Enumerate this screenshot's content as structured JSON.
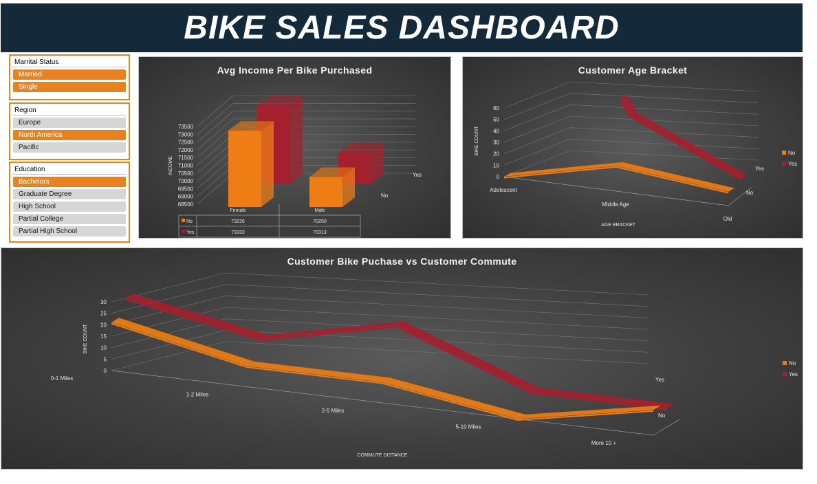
{
  "header": {
    "title": "BIKE SALES DASHBOARD"
  },
  "colors": {
    "no": "#ee7d15",
    "yes": "#a5202e",
    "accent": "#e8821e",
    "header_bg": "#14293a"
  },
  "slicers": {
    "marital": {
      "title": "Marrital Status",
      "items": [
        {
          "label": "Married",
          "selected": true
        },
        {
          "label": "Single",
          "selected": true
        }
      ]
    },
    "region": {
      "title": "Region",
      "items": [
        {
          "label": "Europe",
          "selected": false
        },
        {
          "label": "North America",
          "selected": true
        },
        {
          "label": "Pacific",
          "selected": false
        }
      ]
    },
    "education": {
      "title": "Education",
      "items": [
        {
          "label": "Bachelors",
          "selected": true
        },
        {
          "label": "Graduate Degree",
          "selected": false
        },
        {
          "label": "High School",
          "selected": false
        },
        {
          "label": "Partial College",
          "selected": false
        },
        {
          "label": "Partial High School",
          "selected": false
        }
      ]
    }
  },
  "chart_data": [
    {
      "type": "bar",
      "title": "Avg Income Per Bike Purchased",
      "ylabel": "INCOME",
      "ylim": [
        68500,
        73500
      ],
      "yticks": [
        "73500",
        "73000",
        "72500",
        "72000",
        "71500",
        "71000",
        "70500",
        "70000",
        "69500",
        "69000",
        "68500"
      ],
      "categories": [
        "Female",
        "Male"
      ],
      "series": [
        {
          "name": "No",
          "values": [
            73226,
            70250
          ]
        },
        {
          "name": "Yes",
          "values": [
            73333,
            70313
          ]
        }
      ],
      "table": {
        "headers": [
          "Female",
          "Male"
        ],
        "rows": [
          {
            "label": "No",
            "values": [
              "73226",
              "70250"
            ]
          },
          {
            "label": "Yes",
            "values": [
              "73333",
              "70313"
            ]
          }
        ]
      },
      "depth_labels": [
        "Yes",
        "No"
      ]
    },
    {
      "type": "line",
      "title": "Customer Age Bracket",
      "xlabel": "AGE BRACKET",
      "ylabel": "BIKE COUNT",
      "ylim": [
        0,
        60
      ],
      "yticks": [
        "60",
        "50",
        "40",
        "30",
        "20",
        "10",
        "0"
      ],
      "categories": [
        "Adolescent",
        "Middle Age",
        "Old"
      ],
      "series": [
        {
          "name": "No",
          "values": [
            0,
            22,
            12
          ]
        },
        {
          "name": "Yes",
          "values": [
            null,
            58,
            15
          ]
        }
      ],
      "depth_labels": [
        "Yes",
        "No"
      ],
      "legend": [
        "No",
        "Yes"
      ]
    },
    {
      "type": "line",
      "title": "Customer Bike Puchase vs Customer Commute",
      "xlabel": "COMMUTE DISTANCE",
      "ylabel": "BIKE COUNT",
      "ylim": [
        0,
        30
      ],
      "yticks": [
        "30",
        "25",
        "20",
        "15",
        "10",
        "5",
        "0"
      ],
      "categories": [
        "0-1 Miles",
        "1-2 Miles",
        "2-5 Miles",
        "5-10 Miles",
        "More 10 +"
      ],
      "series": [
        {
          "name": "No",
          "values": [
            21,
            9,
            9,
            0,
            11
          ]
        },
        {
          "name": "Yes",
          "values": [
            28,
            17,
            30,
            8,
            8
          ]
        }
      ],
      "depth_labels": [
        "Yes",
        "No"
      ],
      "legend": [
        "No",
        "Yes"
      ]
    }
  ]
}
